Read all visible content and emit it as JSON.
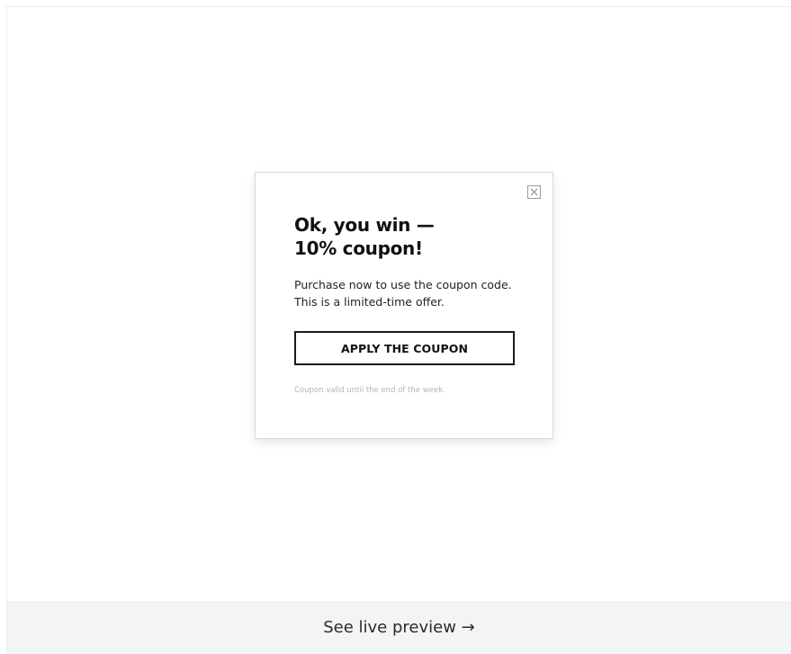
{
  "popup": {
    "close_icon": "close-icon",
    "title_line1": "Ok, you win —",
    "title_line2": "10% coupon!",
    "description_line1": "Purchase now to use the coupon code.",
    "description_line2": "This is a limited-time offer.",
    "button_label": "APPLY THE COUPON",
    "note": "Coupon valid until the end of the week."
  },
  "footer": {
    "link_label": "See live preview →"
  },
  "colors": {
    "background": "#ffffff",
    "footer_background": "#f3f4f6",
    "text": "#111111",
    "muted_text": "#b5b5b5"
  }
}
